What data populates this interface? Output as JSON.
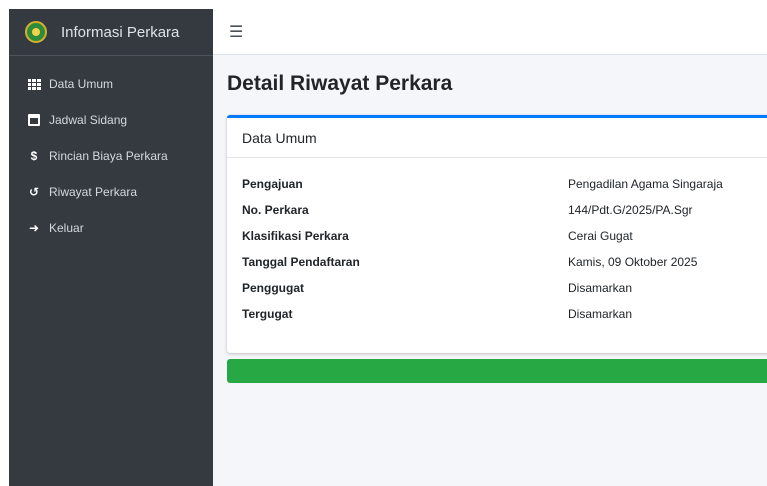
{
  "sidebar": {
    "brand": "Informasi Perkara",
    "items": [
      {
        "label": "Data Umum",
        "icon": "table-icon"
      },
      {
        "label": "Jadwal Sidang",
        "icon": "calendar-icon"
      },
      {
        "label": "Rincian Biaya Perkara",
        "icon": "dollar-icon"
      },
      {
        "label": "Riwayat Perkara",
        "icon": "history-icon"
      },
      {
        "label": "Keluar",
        "icon": "sign-out-icon"
      }
    ]
  },
  "topbar": {
    "menu_icon": "☰"
  },
  "page": {
    "title": "Detail Riwayat Perkara"
  },
  "card": {
    "title": "Data Umum",
    "rows": [
      {
        "label": "Pengajuan",
        "value": "Pengadilan Agama Singaraja"
      },
      {
        "label": "No. Perkara",
        "value": "144/Pdt.G/2025/PA.Sgr"
      },
      {
        "label": "Klasifikasi Perkara",
        "value": "Cerai Gugat"
      },
      {
        "label": "Tanggal Pendaftaran",
        "value": "Kamis, 09 Oktober 2025"
      },
      {
        "label": "Penggugat",
        "value": "Disamarkan"
      },
      {
        "label": "Tergugat",
        "value": "Disamarkan"
      }
    ]
  },
  "colors": {
    "sidebar": "#343a40",
    "accent": "#007bff",
    "success": "#28a745"
  }
}
